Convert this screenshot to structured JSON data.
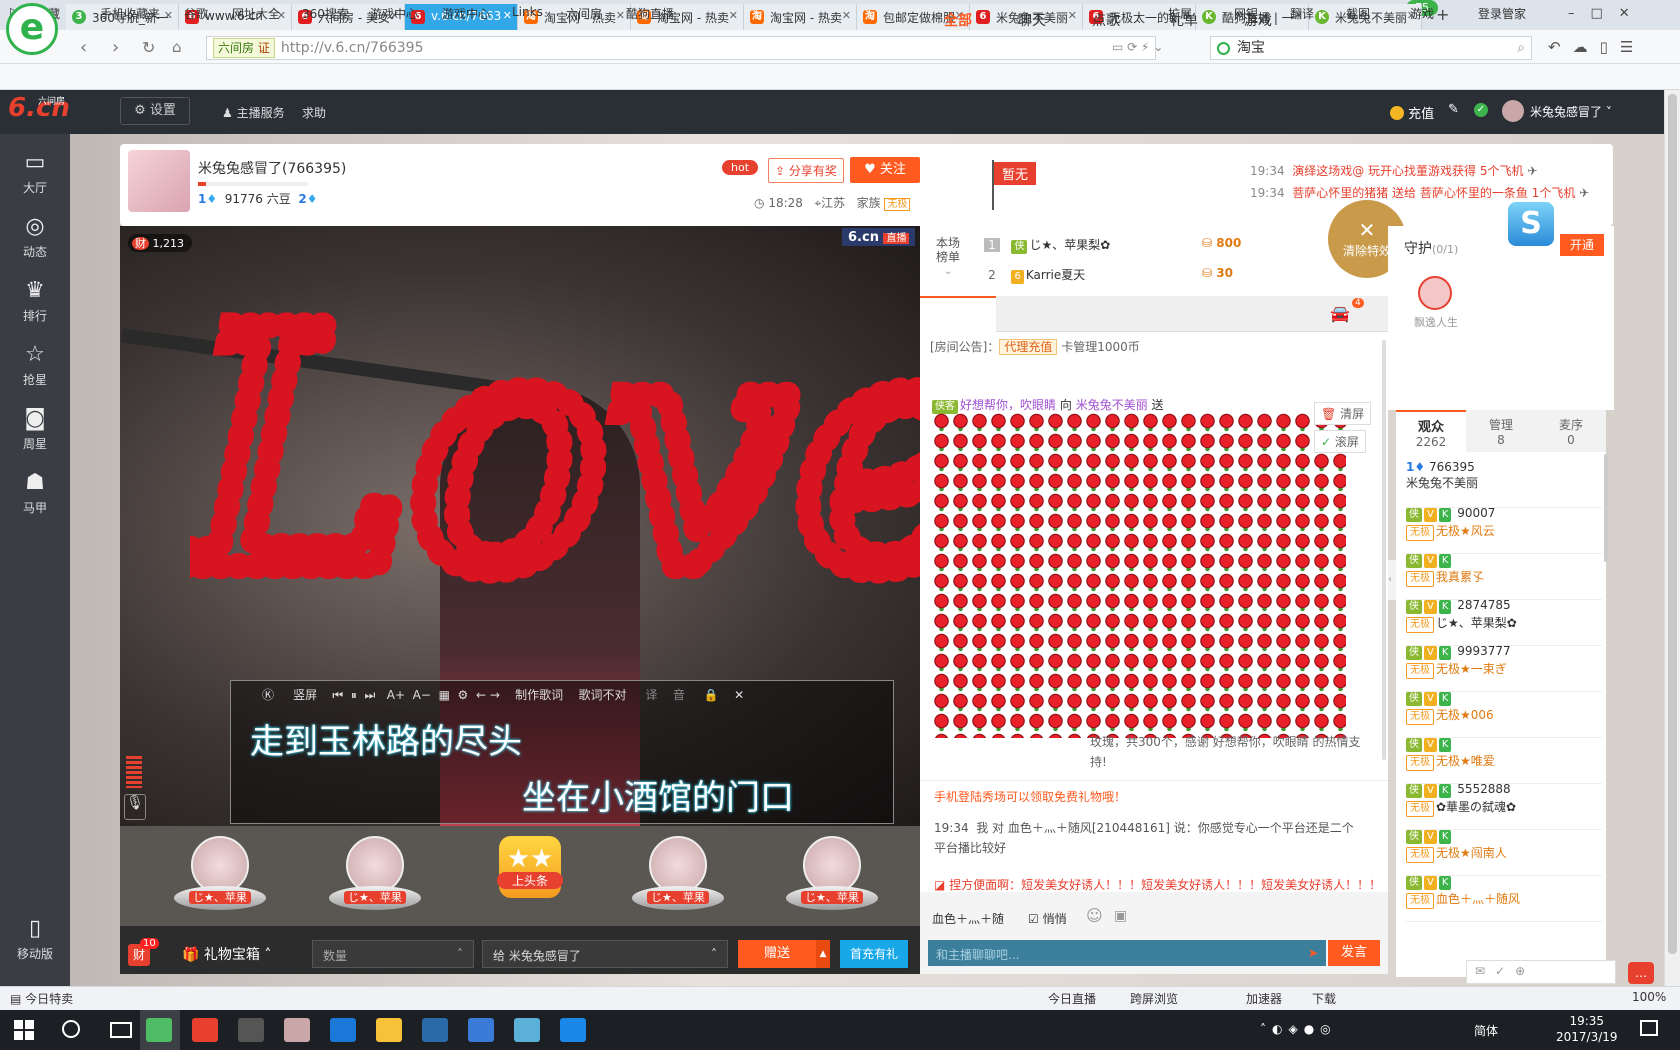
{
  "browser": {
    "tabs": [
      {
        "label": "360导航_新一",
        "icon": "360-icon"
      },
      {
        "label": "www.6.cn",
        "icon": "6cn-icon"
      },
      {
        "label": "六间房 - 美女",
        "icon": "6cn-icon"
      },
      {
        "label": "v.6.cn/7663",
        "icon": "6cn-icon",
        "active": true
      },
      {
        "label": "淘宝网 - 热卖",
        "icon": "taobao-icon"
      },
      {
        "label": "淘宝网 - 热卖",
        "icon": "taobao-icon"
      },
      {
        "label": "淘宝网 - 热卖",
        "icon": "taobao-icon"
      },
      {
        "label": "包邮定做棉服",
        "icon": "taobao-icon"
      },
      {
        "label": "米兔兔不美丽",
        "icon": "6cn-icon"
      },
      {
        "label": "无极太一的新",
        "icon": "6cn-icon"
      },
      {
        "label": "酷狗直播 | 一",
        "icon": "kugou-icon"
      },
      {
        "label": "米兔兔不美丽",
        "icon": "kugou-icon"
      }
    ],
    "badge_count": "75",
    "address_chip": "六间房",
    "address_chip_cert": "证",
    "url": "http://v.6.cn/766395",
    "search_text": "淘宝",
    "bookmarks": [
      "收藏",
      "手机收藏夹",
      "谷歌",
      "网址大全",
      "360搜索",
      "游戏中心",
      "游戏中心",
      "Links",
      "六间房",
      "酷狗直播"
    ],
    "right_tools": [
      "扩展",
      "网银",
      "翻译",
      "截图",
      "游戏",
      "登录管家"
    ]
  },
  "site": {
    "logo_main": "6.cn",
    "logo_sub": "六间房",
    "settings_label": "设置",
    "anchor_service": "主播服务",
    "help": "求助",
    "recharge": "充值",
    "username": "米兔兔感冒了"
  },
  "leftnav": [
    "大厅",
    "动态",
    "排行",
    "抢星",
    "周星",
    "马甲",
    "移动版"
  ],
  "streamer": {
    "name": "米兔兔感冒了(766395)",
    "level": "1",
    "beans": "91776 六豆",
    "level2": "2",
    "hot": "hot",
    "share": "分享有奖",
    "follow": "关注",
    "time": "18:28",
    "location": "江苏",
    "family": "家族",
    "family_tag": "无极",
    "flag": "暂无"
  },
  "announcements": [
    {
      "time": "19:34",
      "text": "演绎这场戏@ 玩开心找董游戏获得 5个飞机"
    },
    {
      "time": "19:34",
      "text": "菩萨心怀里的猪猪 送给 菩萨心怀里的一条鱼 1个飞机"
    }
  ],
  "video": {
    "viewer_count": "1,213",
    "watermark": "6.cn",
    "live_tag": "直播",
    "overlay_text": "Love",
    "lyrics_controls": [
      "竖屏",
      "制作歌词",
      "歌词不对",
      "译",
      "音"
    ],
    "lyric_line1": "走到玉林路的尽头",
    "lyric_line2": "坐在小酒馆的门口"
  },
  "gift_strip": {
    "items": [
      "じ★、苹果",
      "じ★、苹果",
      "上头条",
      "じ★、苹果",
      "じ★、苹果"
    ]
  },
  "gift_bar": {
    "wealth_badge": "10",
    "wealth_label": "财",
    "box": "礼物宝箱",
    "qty_placeholder": "数量",
    "to": "给 米兔兔感冒了",
    "send": "赠送",
    "first": "首充有礼"
  },
  "rank": {
    "title": "本场榜单",
    "rows": [
      {
        "no": "1",
        "name": "じ★、苹果梨✿",
        "score": "800"
      },
      {
        "no": "2",
        "name": "Karrie夏天",
        "score": "30"
      }
    ]
  },
  "clear_effects": "清除特效",
  "chat": {
    "tabs": [
      "全部",
      "聊天",
      "点歌",
      "礼单",
      "游戏"
    ],
    "car_badge": "4",
    "notice_label": "[房间公告]",
    "notice_tag": "代理充值",
    "notice_text": "卡管理1000币",
    "gift_msg_from": "好想帮你，吹眼睛",
    "gift_msg_to": "米兔兔不美丽",
    "gift_msg_verb": "向",
    "gift_msg_send": "送",
    "gift_thanks": "玫瑰，共300个，感谢 好想帮你，吹眼睛 的热情支持!",
    "clear_btn": "清屏",
    "scroll_btn": "滚屏",
    "promo": "手机登陆秀场可以领取免费礼物哦！",
    "msg_time": "19:34",
    "msg_text": "我 对 血色＋灬＋随风[210448161] 说：你感觉专心一个平台还是二个平台播比较好",
    "broadcast": "捏方便面啊：短发美女好诱人！！！短发美女好诱人！！！短发美女好诱人！！！",
    "target": "血色＋灬＋随",
    "whisper": "悄悄",
    "input_placeholder": "和主播聊聊吧...",
    "send": "发言"
  },
  "guard": {
    "title": "守护",
    "count": "(0/1)",
    "open": "开通",
    "user": "飘逸人生"
  },
  "audience": {
    "tabs": [
      {
        "label": "观众",
        "count": "2262"
      },
      {
        "label": "管理",
        "count": "8"
      },
      {
        "label": "麦序",
        "count": "0"
      }
    ],
    "list": [
      {
        "id": "766395",
        "name": "米兔兔不美丽"
      },
      {
        "id": "90007",
        "name": "无极★风云"
      },
      {
        "id": "",
        "name": "我真累孓"
      },
      {
        "id": "2874785",
        "name": "じ★、苹果梨✿"
      },
      {
        "id": "9993777",
        "name": "无极★一束ぎ"
      },
      {
        "id": "",
        "name": "无极★006"
      },
      {
        "id": "",
        "name": "无极★唯爱"
      },
      {
        "id": "5552888",
        "name": "✿華墨の弑魂✿"
      },
      {
        "id": "",
        "name": "无极★闯南人"
      },
      {
        "id": "",
        "name": "血色＋灬＋随风"
      }
    ]
  },
  "statusbar": {
    "left": "今日特卖",
    "items": [
      "今日直播",
      "跨屏浏览",
      "加速器",
      "下载"
    ],
    "zoom": "100%"
  },
  "taskbar": {
    "lang": "简体",
    "time": "19:35",
    "date": "2017/3/19"
  },
  "colors": {
    "accent_orange": "#ff5a1f",
    "tab_active": "#32a8e8",
    "brand_red": "#e8402e"
  }
}
